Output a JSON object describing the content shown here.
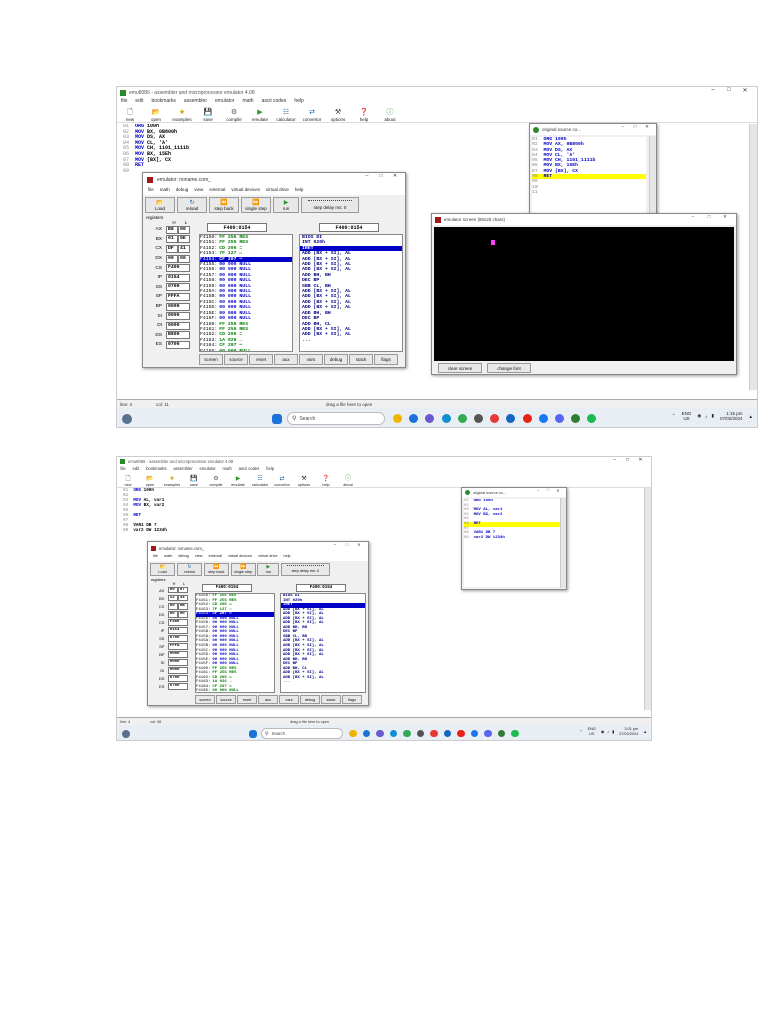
{
  "app": {
    "title_top": "emu8086 - assembler and microprocessor emulator 4.08",
    "title_bottom": "emu8086 - assembler and microprocessor emulator 4.08",
    "menu": [
      "file",
      "edit",
      "bookmarks",
      "assembler",
      "emulator",
      "math",
      "ascii codes",
      "help"
    ],
    "toolbar": [
      "new",
      "open",
      "examples",
      "save",
      "compile",
      "emulate",
      "calculator",
      "convertor",
      "options",
      "help",
      "about"
    ]
  },
  "code_top": [
    {
      "n": "01",
      "kw": "ORG",
      "rest": " 100h"
    },
    {
      "n": "02",
      "kw": "MOV",
      "rest": " BX, 0B800h"
    },
    {
      "n": "03",
      "kw": "MOV",
      "rest": " DS, AX"
    },
    {
      "n": "04",
      "kw": "MOV",
      "rest": " CL, 'A'"
    },
    {
      "n": "05",
      "kw": "MOV",
      "rest": " CH, 1101_1111b"
    },
    {
      "n": "06",
      "kw": "MOV",
      "rest": " BX, 15Eh"
    },
    {
      "n": "07",
      "kw": "MOV",
      "rest": " [BX], CX"
    },
    {
      "n": "08",
      "kw": "RET",
      "rest": ""
    },
    {
      "n": "09",
      "kw": "",
      "rest": ""
    }
  ],
  "code_bottom": [
    {
      "n": "01",
      "kw": "ORG",
      "rest": " 100h"
    },
    {
      "n": "02",
      "kw": "",
      "rest": ""
    },
    {
      "n": "03",
      "kw": "MOV",
      "rest": " AL, var1"
    },
    {
      "n": "04",
      "kw": "MOV",
      "rest": " BX, var2"
    },
    {
      "n": "05",
      "kw": "",
      "rest": ""
    },
    {
      "n": "06",
      "kw": "RET",
      "rest": ""
    },
    {
      "n": "07",
      "kw": "",
      "rest": ""
    },
    {
      "n": "08",
      "kw": "",
      "rest": "VAR1 DB 7"
    },
    {
      "n": "09",
      "kw": "",
      "rest": "var2 DW 1234h"
    }
  ],
  "emulator": {
    "title": "emulator: noname.com_",
    "menu": [
      "file",
      "math",
      "debug",
      "view",
      "external",
      "virtual devices",
      "virtual drive",
      "help"
    ],
    "buttons": [
      "Load",
      "reload",
      "step back",
      "single step",
      "run",
      "step delay ms: 0"
    ],
    "registers_label": "registers",
    "hl_header": [
      "H",
      "L"
    ],
    "mem_header": "F400:0154",
    "dis_header": "F400:0154",
    "bottom_buttons": [
      "screen",
      "source",
      "reset",
      "aux",
      "vars",
      "debug",
      "stack",
      "flags"
    ]
  },
  "regs_top": [
    {
      "name": "AX",
      "h": "B8",
      "l": "00"
    },
    {
      "name": "BX",
      "h": "01",
      "l": "5E"
    },
    {
      "name": "CX",
      "h": "DF",
      "l": "41"
    },
    {
      "name": "DX",
      "h": "00",
      "l": "00"
    },
    {
      "name": "CS",
      "v": "F400"
    },
    {
      "name": "IP",
      "v": "0154"
    },
    {
      "name": "SS",
      "v": "0700"
    },
    {
      "name": "SP",
      "v": "FFFA"
    },
    {
      "name": "BP",
      "v": "0000"
    },
    {
      "name": "SI",
      "v": "0000"
    },
    {
      "name": "DI",
      "v": "0000"
    },
    {
      "name": "DS",
      "v": "B800"
    },
    {
      "name": "ES",
      "v": "0700"
    }
  ],
  "regs_bottom": [
    {
      "name": "AX",
      "h": "00",
      "l": "07"
    },
    {
      "name": "BX",
      "h": "12",
      "l": "34"
    },
    {
      "name": "CX",
      "h": "00",
      "l": "0B"
    },
    {
      "name": "DX",
      "h": "00",
      "l": "00"
    },
    {
      "name": "CS",
      "v": "F400"
    },
    {
      "name": "IP",
      "v": "0154"
    },
    {
      "name": "SS",
      "v": "0700"
    },
    {
      "name": "SP",
      "v": "FFFA"
    },
    {
      "name": "BP",
      "v": "0000"
    },
    {
      "name": "SI",
      "v": "0000"
    },
    {
      "name": "DI",
      "v": "0000"
    },
    {
      "name": "DS",
      "v": "0700"
    },
    {
      "name": "ES",
      "v": "0700"
    }
  ],
  "memory": [
    {
      "a": "F4150:",
      "v": "FF 255 RES"
    },
    {
      "a": "F4151:",
      "v": "FF 255 RES"
    },
    {
      "a": "F4152:",
      "v": "CD 205 ="
    },
    {
      "a": "F4153:",
      "v": "7F 127 ⌂"
    },
    {
      "a": "F4154:",
      "v": "CF 207 ═",
      "sel": true
    },
    {
      "a": "F4155:",
      "v": "00 000 NULL"
    },
    {
      "a": "F4156:",
      "v": "00 000 NULL"
    },
    {
      "a": "F4157:",
      "v": "00 000 NULL"
    },
    {
      "a": "F4158:",
      "v": "00 000 NULL"
    },
    {
      "a": "F4159:",
      "v": "00 000 NULL"
    },
    {
      "a": "F415A:",
      "v": "00 000 NULL"
    },
    {
      "a": "F415B:",
      "v": "00 000 NULL"
    },
    {
      "a": "F415C:",
      "v": "00 000 NULL"
    },
    {
      "a": "F415D:",
      "v": "00 000 NULL"
    },
    {
      "a": "F415E:",
      "v": "00 000 NULL"
    },
    {
      "a": "F415F:",
      "v": "00 000 NULL"
    },
    {
      "a": "F4160:",
      "v": "FF 255 RES"
    },
    {
      "a": "F4161:",
      "v": "FF 255 RES"
    },
    {
      "a": "F4162:",
      "v": "CD 205 ="
    },
    {
      "a": "F4163:",
      "v": "1A 026 →"
    },
    {
      "a": "F4164:",
      "v": "CF 207 ═"
    },
    {
      "a": "F4165:",
      "v": "00 000 NULL"
    }
  ],
  "disasm": [
    {
      "t": "BIOS DI"
    },
    {
      "t": "INT 020h"
    },
    {
      "t": "IRET",
      "sel": true
    },
    {
      "t": "ADD [BX + SI], AL"
    },
    {
      "t": "ADD [BX + SI], AL"
    },
    {
      "t": "ADD [BX + SI], AL"
    },
    {
      "t": "ADD [BX + SI], AL"
    },
    {
      "t": "ADD BH, BH"
    },
    {
      "t": "DEC BP"
    },
    {
      "t": "SBB CL, BH"
    },
    {
      "t": "ADD [BX + SI], AL"
    },
    {
      "t": "ADD [BX + SI], AL"
    },
    {
      "t": "ADD [BX + SI], AL"
    },
    {
      "t": "ADD [BX + SI], AL"
    },
    {
      "t": "ADD BH, BH"
    },
    {
      "t": "DEC BP"
    },
    {
      "t": "ADD BH, CL"
    },
    {
      "t": "ADD [BX + SI], AL"
    },
    {
      "t": "ADD [BX + SI], AL"
    },
    {
      "t": "..."
    }
  ],
  "source_win": {
    "title": "original source co...",
    "top": [
      {
        "n": "01",
        "t": "ORG 100h"
      },
      {
        "n": "02",
        "t": "MOV AX, 0B800h"
      },
      {
        "n": "03",
        "t": "MOV DS, AX"
      },
      {
        "n": "04",
        "t": "MOV CL, 'A'"
      },
      {
        "n": "05",
        "t": "MOV CH, 1101_1111b"
      },
      {
        "n": "06",
        "t": "MOV BX, 15Eh"
      },
      {
        "n": "07",
        "t": "MOV [BX], CX"
      },
      {
        "n": "08",
        "t": "RET",
        "hl": true
      },
      {
        "n": "09",
        "t": ""
      },
      {
        "n": "10",
        "t": ""
      },
      {
        "n": "11",
        "t": ""
      }
    ],
    "bottom": [
      {
        "n": "01",
        "t": "ORG 100h"
      },
      {
        "n": "02",
        "t": ""
      },
      {
        "n": "03",
        "t": "MOV AL, var1"
      },
      {
        "n": "04",
        "t": "MOV BX, var2"
      },
      {
        "n": "05",
        "t": ""
      },
      {
        "n": "06",
        "t": "RET",
        "hl": true
      },
      {
        "n": "07",
        "t": ""
      },
      {
        "n": "08",
        "t": "VAR1 DB 7"
      },
      {
        "n": "09",
        "t": "var2 DW 1234h"
      }
    ]
  },
  "screen_win": {
    "title": "emulator screen (80x25 chars)",
    "buttons": [
      "clear screen",
      "change font"
    ]
  },
  "status_top": {
    "line": "line: 4",
    "col": "col: 11",
    "drag": "drag a file here to open"
  },
  "status_bottom": {
    "line": "line: 4",
    "col": "col: 98",
    "drag": "drag a file here to open"
  },
  "taskbar": {
    "search": "Search",
    "lang": "ENG",
    "region": "US",
    "time_top": "1:15 pm",
    "date_top": "07/02/2024",
    "time_bottom": "3:21 pm",
    "date_bottom": "07/02/2024"
  },
  "colors": {
    "kw": "#0000c8",
    "hl": "#ffff00",
    "sel": "#0000c8",
    "mem_val": "#008000"
  }
}
